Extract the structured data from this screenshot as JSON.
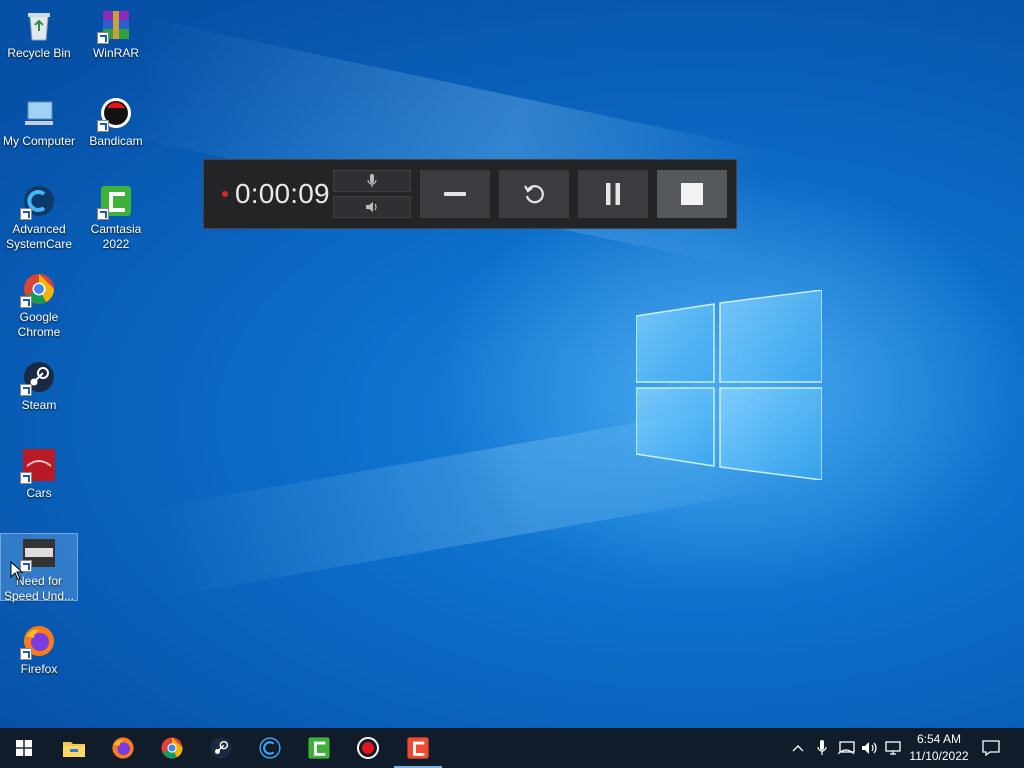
{
  "desktop_icons": [
    {
      "label": "Recycle Bin",
      "icon": "recycle-bin-icon"
    },
    {
      "label": "WinRAR",
      "icon": "winrar-icon"
    },
    {
      "label": "My Computer",
      "icon": "computer-icon"
    },
    {
      "label": "Bandicam",
      "icon": "bandicam-icon"
    },
    {
      "label": "Advanced SystemCare",
      "icon": "advanced-systemcare-icon"
    },
    {
      "label": "Camtasia 2022",
      "icon": "camtasia-icon"
    },
    {
      "label": "Google Chrome",
      "icon": "chrome-icon"
    },
    {
      "label": "Steam",
      "icon": "steam-icon"
    },
    {
      "label": "Cars",
      "icon": "cars-icon"
    },
    {
      "label": "Need for Speed Und...",
      "icon": "nfs-icon"
    },
    {
      "label": "Firefox",
      "icon": "firefox-icon"
    }
  ],
  "recorder": {
    "elapsed": "0:00:09",
    "recording_color": "#d8262a",
    "buttons": [
      "mic-icon",
      "speaker-icon",
      "minimize-icon",
      "restart-icon",
      "pause-icon",
      "stop-icon"
    ]
  },
  "taskbar": {
    "apps": [
      "start-icon",
      "file-explorer-icon",
      "firefox-icon",
      "chrome-icon",
      "steam-icon",
      "advanced-systemcare-icon",
      "camtasia-icon",
      "bandicam-icon",
      "camtasia-recorder-icon"
    ],
    "active_app": "camtasia-recorder-icon",
    "tray": [
      "chevron-up-icon",
      "mic-icon",
      "network-icon",
      "volume-icon",
      "display-icon"
    ],
    "time": "6:54 AM",
    "date": "11/10/2022"
  },
  "colors": {
    "taskbar_bg": "#101c2a",
    "desktop_accent": "#0c6cc8",
    "recorder_bg": "#222426"
  }
}
